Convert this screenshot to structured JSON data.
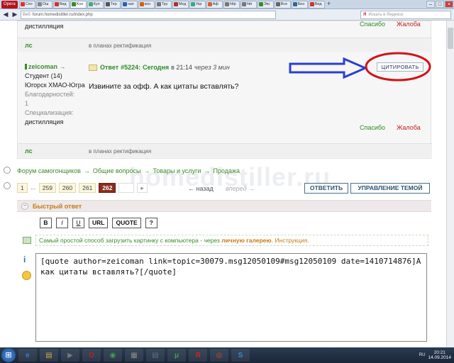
{
  "browser": {
    "menu_label": "Opera",
    "tabs": [
      {
        "label": "Спо",
        "color": "#d33"
      },
      {
        "label": "Ош",
        "color": "#888"
      },
      {
        "label": "Вид",
        "color": "#c33"
      },
      {
        "label": "Kox",
        "color": "#3b8b2a",
        "active": true
      },
      {
        "label": "Кул",
        "color": "#4a7"
      },
      {
        "label": "Тер",
        "color": "#555"
      },
      {
        "label": "нап",
        "color": "#2a62b0"
      },
      {
        "label": "кон",
        "color": "#c60"
      },
      {
        "label": "Тру",
        "color": "#777"
      },
      {
        "label": "Мед",
        "color": "#a33"
      },
      {
        "label": "Укр",
        "color": "#3a8"
      },
      {
        "label": "Аф",
        "color": "#c63"
      },
      {
        "label": "http",
        "color": "#777"
      },
      {
        "label": "httr",
        "color": "#777"
      },
      {
        "label": "Экс",
        "color": "#3b8b2a"
      },
      {
        "label": "Все",
        "color": "#666"
      },
      {
        "label": "Бен",
        "color": "#369"
      },
      {
        "label": "Вид",
        "color": "#c33"
      }
    ],
    "new_tab": "+",
    "win_min": "–",
    "win_max": "□",
    "win_close": "×",
    "back": "◀",
    "forward": "▶",
    "web_label": "Веб",
    "url": "forum.homedistiller.ru/index.php",
    "search_brand": "Я",
    "search_placeholder": "Искать в Яндексе"
  },
  "top_fragment": {
    "text": "дистилляция",
    "thanks": "Спасибо",
    "complain": "Жалоба",
    "ls": "лс",
    "signature": "в планах ректификация"
  },
  "post": {
    "author": "zeicoman",
    "author_arrow": "→",
    "status": "Студент (14)",
    "location": "Югорск ХМАО-Югра",
    "thanks_label": "Благодарностей:",
    "thanks_count": "1",
    "spec_label": "Специализация:",
    "spec_value": "дистилляция",
    "reply_label": "Ответ",
    "post_number": "#5224:",
    "date": "Сегодня",
    "time_prefix": "в 21:14",
    "edited": "через 3 мин",
    "quote_button": "ЦИТИРОВАТЬ",
    "body": "Извините за офф. А как цитаты вставлять?",
    "thanks": "Спасибо",
    "complain": "Жалоба",
    "ls": "лс",
    "signature": "в планах ректификация"
  },
  "breadcrumb": [
    "Форум самогонщиков",
    "Общие вопросы",
    "Товары и услуги",
    "Продажа"
  ],
  "breadcrumb_sep": "→",
  "pager": {
    "pages": [
      "1",
      "...",
      "259",
      "260",
      "261",
      "262"
    ],
    "current": "262",
    "next_arrow": "▸",
    "back_label": "← назад",
    "fwd_label": "вперед →",
    "reply_button": "ОТВЕТИТЬ",
    "manage_button": "УПРАВЛЕНИЕ ТЕМОЙ"
  },
  "quick_reply": {
    "title": "Быстрый ответ",
    "collapse_glyph": "−",
    "toolbar": [
      "B",
      "I",
      "U",
      "URL",
      "QUOTE",
      "?"
    ],
    "hint_prefix": "Самый простой способ загрузить картинку с компьютера - через ",
    "hint_link": "личную галерею",
    "hint_suffix": ". ",
    "hint_instr": "Инструкция.",
    "editor_value": "[quote author=zeicoman link=topic=30079.msg12050109#msg12050109 date=1410714876]А как цитаты вставлять?[/quote]",
    "info_icon": "i"
  },
  "watermark": "homedistiller.ru",
  "taskbar": {
    "start": "⊞",
    "apps": [
      {
        "label": "e",
        "color": "#2d7fd6"
      },
      {
        "label": "▤",
        "color": "#d9a63a"
      },
      {
        "label": "▶",
        "color": "#777"
      },
      {
        "label": "O",
        "color": "#c41c1c"
      },
      {
        "label": "◉",
        "color": "#3aa34a"
      },
      {
        "label": "▦",
        "color": "#8a8a8a"
      },
      {
        "label": "▤",
        "color": "#5c6f8a"
      },
      {
        "label": "μ",
        "color": "#3aa34a"
      },
      {
        "label": "Я",
        "color": "#d42020"
      },
      {
        "label": "◎",
        "color": "#d44a20"
      },
      {
        "label": "S",
        "color": "#2b8fd8"
      }
    ],
    "lang": "RU",
    "time": "20:21",
    "date": "14.09.2014"
  },
  "colors": {
    "green": "#3b8b2a",
    "red": "#c02222",
    "annotation_blue": "#2a3fd6",
    "annotation_red": "#d0141a",
    "current_page": "#8a2d1f"
  }
}
